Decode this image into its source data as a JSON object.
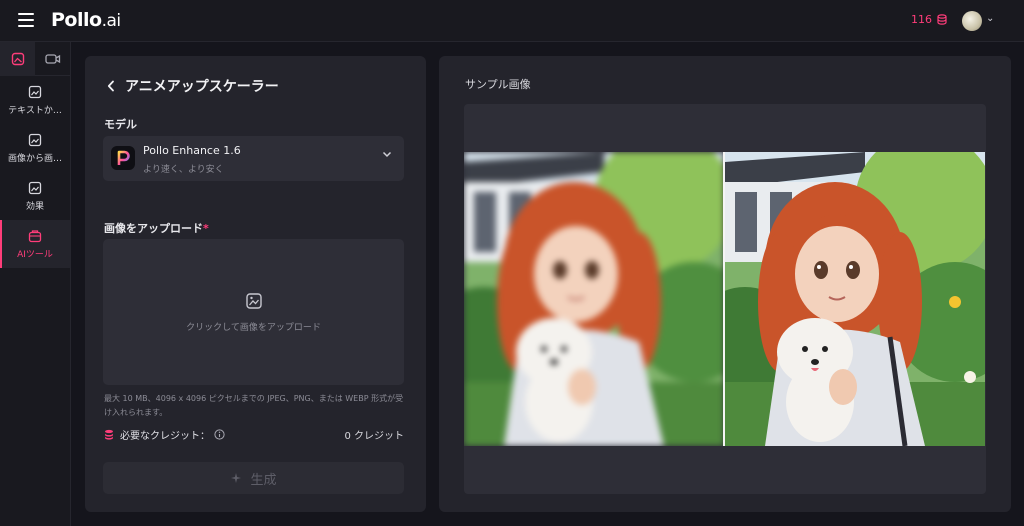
{
  "header": {
    "logo_main": "Pollo",
    "logo_suffix": ".ai",
    "credits": "116"
  },
  "rail": {
    "items": [
      {
        "label": "テキストか…",
        "icon": "text-to-image-icon"
      },
      {
        "label": "画像から画…",
        "icon": "image-to-image-icon"
      },
      {
        "label": "効果",
        "icon": "effects-icon"
      },
      {
        "label": "AIツール",
        "icon": "ai-tools-icon"
      }
    ]
  },
  "left_panel": {
    "title": "アニメアップスケーラー",
    "model_label": "モデル",
    "model_name": "Pollo Enhance 1.6",
    "model_sub": "より速く、より安く",
    "upload_label": "画像をアップロード",
    "upload_required": "*",
    "upload_text": "クリックして画像をアップロード",
    "hint": "最大 10 MB、4096 x 4096 ピクセルまでの JPEG、PNG、または WEBP 形式が受け入れられます。",
    "credits_label": "必要なクレジット：",
    "credits_value": "0 クレジット",
    "generate_label": "生成"
  },
  "right_panel": {
    "title": "サンプル画像"
  },
  "colors": {
    "accent": "#ff3d7a",
    "panel": "#24242c",
    "field": "#2e2e37"
  }
}
